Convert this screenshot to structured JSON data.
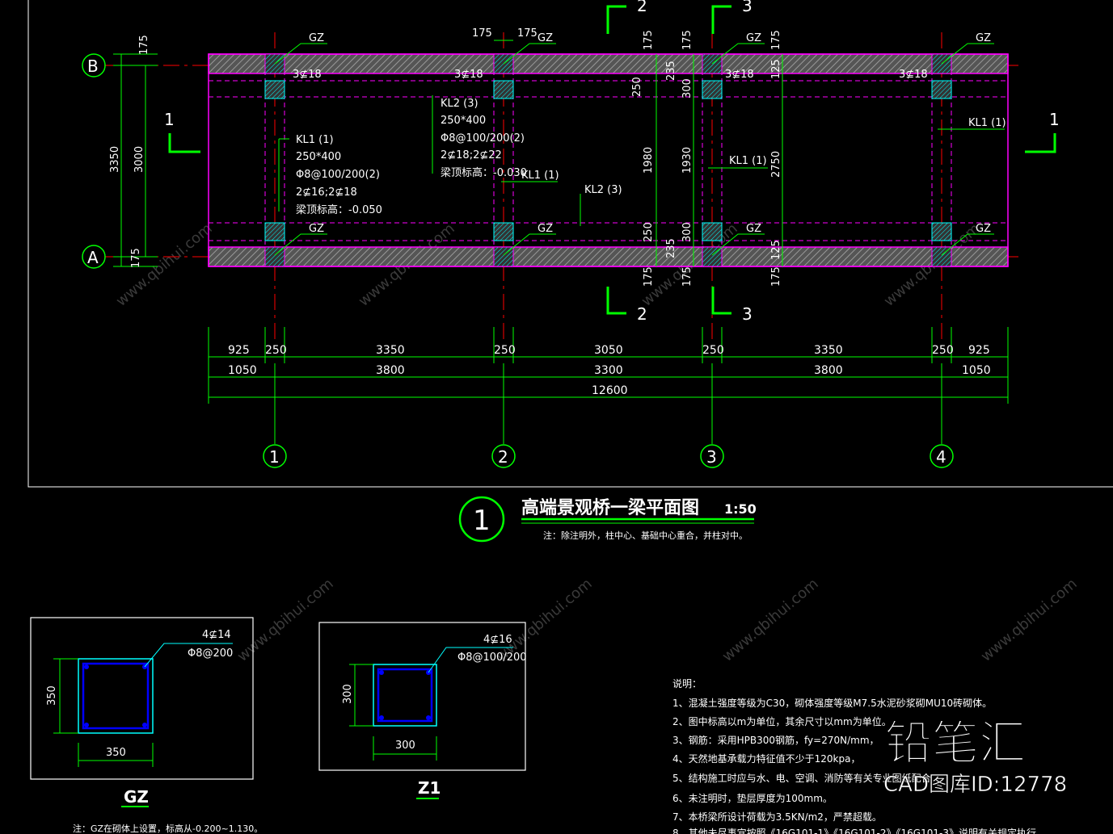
{
  "plan": {
    "axes_rows": [
      "B",
      "A"
    ],
    "axes_cols": [
      "1",
      "2",
      "3",
      "4"
    ],
    "section_marks": [
      "1",
      "1",
      "2",
      "2",
      "3",
      "3"
    ],
    "gz_label": "GZ",
    "rebar_top": "3⊈18",
    "kl1": {
      "name": "KL1 (1)",
      "size": "250*400",
      "stirrup": "Φ8@100/200(2)",
      "bars": "2⊈16;2⊈18",
      "elev": "梁顶标高：-0.050"
    },
    "kl2": {
      "name": "KL2 (3)",
      "size": "250*400",
      "stirrup": "Φ8@100/200(2)",
      "bars": "2⊈18;2⊈22",
      "elev": "梁顶标高：-0.030"
    },
    "kl1_mid": "KL1 (1)",
    "kl2_mid": "KL2 (3)",
    "kl1_right": "KL1 (1)",
    "kl1_right2": "KL1 (1)",
    "dims_left": {
      "d175a": "175",
      "d3350": "3350",
      "d3000": "3000",
      "d175b": "175"
    },
    "dims_top": {
      "d175": "175",
      "d175b": "175"
    },
    "dims_v2": [
      "175",
      "250",
      "1980",
      "250",
      "175"
    ],
    "dims_v2b": [
      "175",
      "235",
      "300",
      "1930",
      "300",
      "235",
      "175"
    ],
    "dims_v3": [
      "175",
      "125",
      "2750",
      "125",
      "175"
    ],
    "dims_row1": [
      "925",
      "250",
      "3350",
      "250",
      "3050",
      "250",
      "3350",
      "250",
      "925"
    ],
    "dims_row2": [
      "1050",
      "3800",
      "3300",
      "3800",
      "1050"
    ],
    "dims_total": "12600"
  },
  "title": {
    "number": "1",
    "text": "高端景观桥一梁平面图",
    "scale": "1:50",
    "note": "注：除注明外，柱中心、基础中心重合，并柱对中。"
  },
  "gz_detail": {
    "rebar": "4⊈14",
    "stirrup": "Φ8@200",
    "h": "350",
    "w": "350",
    "name": "GZ",
    "note": "注：GZ在砌体上设置，标高从-0.200~1.130。"
  },
  "z1_detail": {
    "rebar": "4⊈16",
    "stirrup": "Φ8@100/200",
    "h": "300",
    "w": "300",
    "name": "Z1"
  },
  "notes": {
    "heading": "说明：",
    "items": [
      "1、混凝土强度等级为C30，砌体强度等级M7.5水泥砂浆砌MU10砖砌体。",
      "2、图中标高以m为单位，其余尺寸以mm为单位。",
      "3、钢筋：采用HPB300钢筋，fy=270N/mm，",
      "4、天然地基承载力特征值不少于120kpa，",
      "5、结构施工时应与水、电、空调、消防等有关专业图纸配合",
      "6、未注明时，垫层厚度为100mm。",
      "7、本桥梁所设计荷载为3.5KN/m2，严禁超载。",
      "8、其他未尽事宜按照《16G101-1》《16G101-2》《16G101-3》说明有关规定执行"
    ]
  },
  "branding": {
    "logo": "铅笔汇",
    "id_text": "CAD图库ID:12778"
  },
  "watermark": "www.qbihui.com",
  "colors": {
    "background": "#000000",
    "magenta": "#ff00ff",
    "green": "#00ff00",
    "red": "#ff0000",
    "cyan": "#00ffff",
    "blue": "#0000ff",
    "white": "#ffffff",
    "grey": "#808080"
  }
}
